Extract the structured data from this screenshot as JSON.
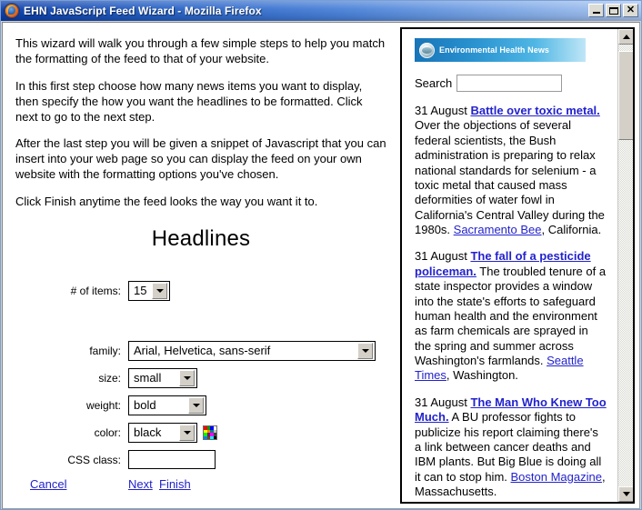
{
  "window": {
    "title": "EHN JavaScript Feed Wizard - Mozilla Firefox",
    "app_icon": "firefox-icon",
    "buttons": {
      "minimize": "minimize-button",
      "maximize": "maximize-button",
      "close_label": "✕"
    }
  },
  "wizard": {
    "paragraphs": [
      "This wizard will walk you through a few simple steps to help you match the formatting of the feed to that of your website.",
      "In this first step choose how many news items you want to display, then specify the how you want the headlines to be formatted. Click next to go to the next step.",
      "After the last step you will be given a snippet of Javascript that you can insert into your web page so you can display the feed on your own website with the formatting options you've chosen.",
      "Click Finish anytime the feed looks the way you want it to."
    ],
    "section_title": "Headlines",
    "fields": {
      "items": {
        "label": "# of items:",
        "value": "15"
      },
      "family": {
        "label": "family:",
        "value": "Arial, Helvetica, sans-serif"
      },
      "size": {
        "label": "size:",
        "value": "small"
      },
      "weight": {
        "label": "weight:",
        "value": "bold"
      },
      "color": {
        "label": "color:",
        "value": "black"
      },
      "css_class": {
        "label": "CSS class:",
        "value": "",
        "placeholder": ""
      }
    },
    "color_picker_icon": "color-palette-icon",
    "links": {
      "cancel": "Cancel",
      "next": "Next",
      "finish": "Finish"
    }
  },
  "preview": {
    "banner": {
      "site_name": "Environmental Health News",
      "logo_icon": "ehn-globe-logo-icon"
    },
    "search": {
      "label": "Search",
      "value": "",
      "placeholder": ""
    },
    "stories": [
      {
        "date": "31 August",
        "headline": "Battle over toxic metal.",
        "body": " Over the objections of several federal scientists, the Bush administration is preparing to relax national standards for selenium - a toxic metal that caused mass deformities of water fowl in California's Central Valley during the 1980s. ",
        "source": "Sacramento Bee",
        "source_suffix": ", California."
      },
      {
        "date": "31 August",
        "headline": "The fall of a pesticide policeman.",
        "body": " The troubled tenure of a state inspector provides a window into the state's efforts to safeguard human health and the environment as farm chemicals are sprayed in the spring and summer across Washington's farmlands. ",
        "source": "Seattle Times",
        "source_suffix": ", Washington."
      },
      {
        "date": "31 August",
        "headline": "The Man Who Knew Too Much.",
        "body": " A BU professor fights to publicize his report claiming there's a link between cancer deaths and IBM plants. But Big Blue is doing all it can to stop him. ",
        "source": "Boston Magazine",
        "source_suffix": ", Massachusetts."
      }
    ],
    "scrollbar": {
      "up_icon": "scroll-up-arrow-icon",
      "down_icon": "scroll-down-arrow-icon"
    }
  },
  "colors": {
    "titlebar_blue": "#0a3da8",
    "link_blue": "#2222cc",
    "banner_blue": "#1774b8",
    "control_face": "#d4d0c8"
  }
}
